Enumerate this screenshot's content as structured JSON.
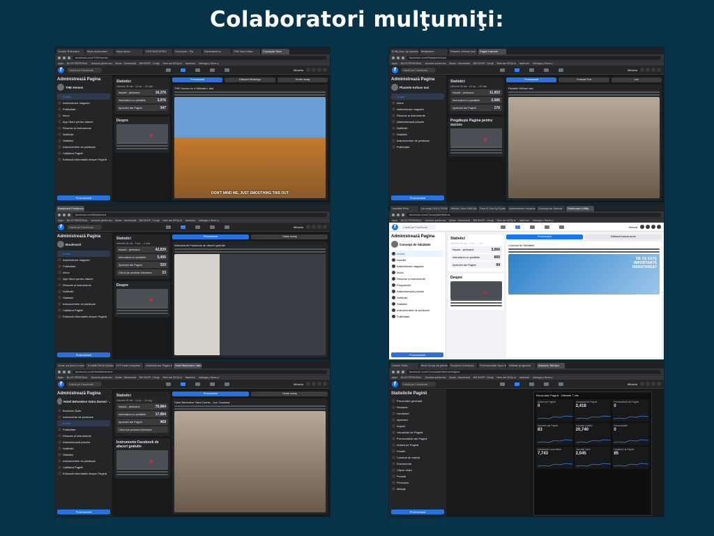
{
  "headline": "Colaboratori mulţumiţi:",
  "shots": [
    {
      "theme": "dark",
      "tabs": [
        "Cookie Polumare",
        "https://polumare",
        "https://polu",
        "SITE BUFOPRO",
        "Concepte - Pyl",
        "Generated cu",
        "THE Hom Vitae",
        "Concepte Hom"
      ],
      "url": "facebook.com/THEHomes",
      "bookmarks": [
        "Apps",
        "BLOG PERSONAL",
        "Anunturi pentru tau",
        "Boost - Generează",
        "BM SHOP - Googl",
        "Here are 9S7ip to",
        "facebook",
        "Intreaga y Serve y"
      ],
      "search": "Caută pe Facebook",
      "user": "Mihaela",
      "sidebar_title": "Administrează Pagina",
      "page_name": "THE Homes",
      "sidebar_items": [
        "Acasă",
        "Administrare magazin",
        "Publicitate",
        "Inbox",
        "App Store pentru afaceri",
        "Resurse și instrumente",
        "Notificări",
        "Statistici",
        "Instrumentele de publicare",
        "Calitatea Paginii",
        "Editează informațiile despre Pagină"
      ],
      "promo": "Promovează",
      "stats_title": "Statistici",
      "stats_sub": "Ultimele 28 zile · 23 iun. – 20 iulie",
      "stats": [
        {
          "label": "Impact - persoane",
          "value": "16,376"
        },
        {
          "label": "Interacțiuni cu postările",
          "value": "3,976"
        },
        {
          "label": "Aprecieri ale Paginii",
          "value": "347"
        }
      ],
      "about": "Despre",
      "post_text": "THE Homes cu în Bârsănu, Iași",
      "caption": "DON'T MIND ME, JUST SMOOTHING THIS OUT",
      "actions": [
        "Promovează",
        "Editează WhatsApp",
        "Trimite mesaj"
      ]
    },
    {
      "theme": "dark",
      "tabs": [
        "Ei By Ana, by mpreuer",
        "Mofassore",
        "Plantele Kefuse Iasi",
        "Pagini Internet"
      ],
      "url": "facebook.com/PlanteleKefuse",
      "bookmarks": [
        "Apps",
        "BLOG PERSONAL",
        "Anunturi pentru tau",
        "Boost - Generează",
        "BM SHOP - Googl",
        "Here are 9S7ip to",
        "facebook",
        "Intreaga y Serve y"
      ],
      "search": "Caută pe Facebook",
      "user": "Mihaela",
      "sidebar_title": "Administrează Pagina",
      "page_name": "Plantele Kefuse Iasi",
      "sidebar_items": [
        "Acasă",
        "Inbox",
        "Administrare magazin",
        "Resurse și instrumente",
        "Administrează joburile",
        "Notificări",
        "Statistici",
        "Instrumentele de publicare",
        "Publicitate"
      ],
      "promo": "Promovează",
      "stats_title": "Statistici",
      "stats_sub": "Ultimele 28 zile · 23 iun. – 20 iulie",
      "stats": [
        {
          "label": "Impact - persoane",
          "value": "11,902"
        },
        {
          "label": "Interacțiuni cu postările",
          "value": "2,086"
        },
        {
          "label": "Aprecieri ale Paginii",
          "value": "176"
        }
      ],
      "about": "Pregătește Pagina pentru succes",
      "post_text": "Plantele Kefuse Iasi",
      "caption": "",
      "actions": [
        "Promovează",
        "Creează Post",
        "Live"
      ]
    },
    {
      "theme": "dark",
      "tabs": [
        "Boulevard Facebook"
      ],
      "url": "facebook.com/Boulevard",
      "bookmarks": [
        "Apps",
        "BLOG PERSONAL",
        "Anunturi pentru tau",
        "Boost - Generează",
        "BM SHOP - Googl",
        "Here are 9S7ip to",
        "facebook",
        "Intreaga y Serve y"
      ],
      "search": "Caută pe Facebook",
      "user": "Mihaela",
      "sidebar_title": "Administrează Pagina",
      "page_name": "Boulevard",
      "sidebar_items": [
        "Acasă",
        "Administrare magazin",
        "Publicitate",
        "Inbox",
        "App Store pentru afaceri",
        "Resurse și instrumente",
        "Notificări",
        "Statistici",
        "Instrumentele de publicare",
        "Calitatea Paginii",
        "Editează informațiile despre Pagină"
      ],
      "promo": "Promovează",
      "stats_title": "Statistici",
      "stats_sub": "Ultimele 28 zile · 5 iun. – 2 iulie",
      "stats": [
        {
          "label": "Impact - persoane",
          "value": "42,839"
        },
        {
          "label": "Interacțiuni cu postările",
          "value": "5,405"
        },
        {
          "label": "Aprecieri ale Paginii",
          "value": "320"
        },
        {
          "label": "Clicuri pe produse informare",
          "value": "23"
        }
      ],
      "about": "Despre",
      "post_text": "Instrumente Facebook de afaceri gratuite",
      "caption": "",
      "actions": [
        "Promovează",
        "Trimite mesaj"
      ]
    },
    {
      "theme": "light",
      "tabs": [
        "Hoodies Pers",
        "La ocupi SOLUTIONIES",
        "Official Color XBX Bo",
        "Face 5 Get Sp Eputs",
        "Administrare reclamei",
        "Concept de Selena",
        "Dashboard Utility"
      ],
      "url": "facebook.com/ConceptdeSelena",
      "bookmarks": [
        "Apps",
        "BLOG PERSONAL",
        "Anunturi pentru tau",
        "Boost - Generează",
        "BM SHOP - Googl",
        "Here are 9S7ip to",
        "facebook",
        "Intreaga y Serve y"
      ],
      "search": "Caută pe Facebook",
      "user": "Selena",
      "sidebar_title": "Administrează Pagina",
      "page_name": "Concept de Sănătate",
      "sidebar_items": [
        "Acasă",
        "Noutăți",
        "Administrare magazin",
        "Inbox",
        "Resurse și instrumente",
        "Programări",
        "Administrează joburile",
        "Notificări",
        "Statistici",
        "Instrumentele de publicare",
        "Publicitate"
      ],
      "promo": "Promovează",
      "stats_title": "Statistici",
      "stats_sub": "Ultimele 28 zile · 4 iun. – 1 iul.",
      "stats": [
        {
          "label": "Impact - persoane",
          "value": "3,566"
        },
        {
          "label": "Interacțiuni cu postările",
          "value": "660"
        },
        {
          "label": "Aprecieri ale Paginii",
          "value": "64"
        }
      ],
      "about": "Despre",
      "post_text": "Concept de Sănătate",
      "caption": "DE CE ESTE IMPORTANTĂ HIDRATAREA?",
      "actions": [
        "Promovează",
        "Editează butonul acum"
      ]
    },
    {
      "theme": "dark",
      "tabs": [
        "Vreau sa pierzi o faza",
        "TrustMit Rb50 Windows",
        "HTI 'trade template' - website",
        "Administrare Pagini reclame",
        "Hotel Belvedere Vatra"
      ],
      "url": "facebook.com/HotelBelvedere",
      "bookmarks": [
        "Apps",
        "BLOG PERSONAL",
        "Anunturi pentru tau",
        "Boost - Generează",
        "BM SHOP - Googl",
        "Here are 9S7ip to",
        "facebook",
        "Intreaga y Serve y"
      ],
      "search": "Caută pe Facebook",
      "user": "Mihaela",
      "sidebar_title": "Administrează Pagina",
      "page_name": "Hotel Belvedere Vatra Dornei - Jud. Suceava",
      "sidebar_items": [
        "Business Suite",
        "Instrumente de publicare",
        "Acasă",
        "Publicitate",
        "Resurse și instrumente",
        "Administrează joburile",
        "Notificări",
        "Statistici",
        "Instrumentele de publicare",
        "Calitatea Paginii",
        "Editează informațiile despre Pagină"
      ],
      "promo": "Promovează",
      "stats_title": "Statistici",
      "stats_sub": "Ultimele 28 zile · 14 iul. – 10 aug.",
      "stats": [
        {
          "label": "Impact - persoane",
          "value": "70,984"
        },
        {
          "label": "Interacțiuni cu postările",
          "value": "17,984"
        },
        {
          "label": "Aprecieri ale Paginii",
          "value": "469"
        },
        {
          "label": "Clicuri pe produse informare",
          "value": ""
        }
      ],
      "about": "Instrumente Facebook de afaceri gratuite",
      "post_text": "Hotel Belvedere Vatra Dornei - Jud. Suceava",
      "caption": "",
      "actions": [
        "Promovează",
        "Trimite mesaj"
      ]
    },
    {
      "theme": "dark",
      "tabs": [
        "Cookie Suite",
        "Best Group de plumbare",
        "Scorpion Solutions",
        "Professionale Sync Website",
        "Affiliate programs",
        "Aducere Tehnica"
      ],
      "url": "facebook.com/ConceptdeSelena/insights",
      "bookmarks": [
        "Apps",
        "BLOG PERSONAL",
        "Anunturi pentru tau",
        "Boost - Generează",
        "BM SHOP - Googl",
        "Here are 9S7ip to",
        "facebook",
        "Intreaga y Serve y"
      ],
      "search": "Caută pe Facebook",
      "user": "Mihaela",
      "sidebar_title": "Statisticile Paginii",
      "page_name": "Concept de Sănătate",
      "sidebar_items": [
        "Prezentare generală",
        "Reclame",
        "Urmăritori",
        "Aprecieri",
        "Impact",
        "Vizualizări de Pagină",
        "Previzualizări ale Paginii",
        "Acțiuni pe Pagină",
        "Postări",
        "Conținut de marcă",
        "Evenimente",
        "Clipuri video",
        "Povești",
        "Persoane",
        "Mesaje"
      ],
      "promo": "Promovează",
      "insights_head": "Rezumatul Paginii · Ultimele 7 zile",
      "insights": [
        {
          "label": "Acțiuni pe Pagină",
          "value": "0"
        },
        {
          "label": "Vizualizări de Pagină",
          "value": "2,418"
        },
        {
          "label": "Previzualizări ale Paginii",
          "value": "0"
        },
        {
          "label": "Aprecieri ale Paginii",
          "value": "83"
        },
        {
          "label": "Impactul postării",
          "value": "20,740"
        },
        {
          "label": "Recomandări",
          "value": "0"
        },
        {
          "label": "Interacțiuni cu postările",
          "value": "7,743"
        },
        {
          "label": "Vizionări video",
          "value": "2,045"
        },
        {
          "label": "Urmăritori ai Paginii",
          "value": "85"
        }
      ]
    }
  ]
}
